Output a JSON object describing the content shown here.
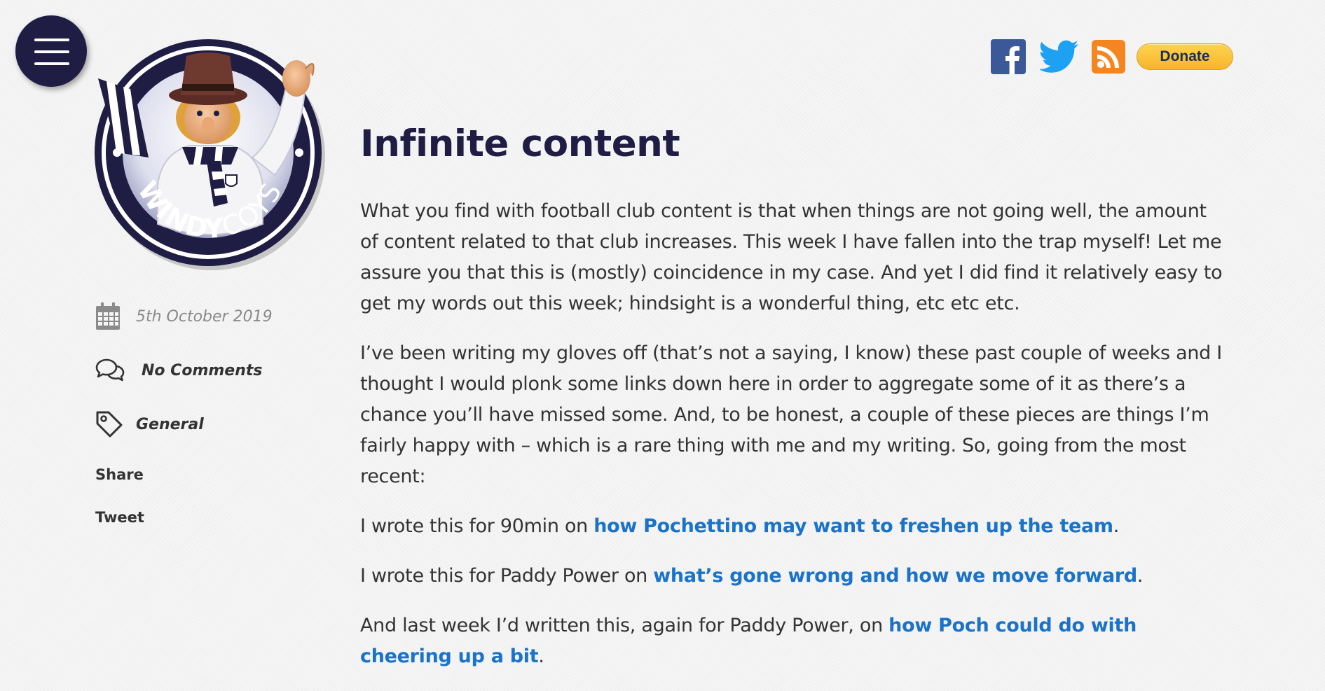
{
  "site": {
    "logo_text_bold": "WINDY",
    "logo_text_light": "COYS"
  },
  "header": {
    "donate_label": "Donate",
    "brand_colors": {
      "navy": "#201d44",
      "facebook": "#3b5998",
      "twitter": "#1da1f2",
      "rss": "#f5851f",
      "link": "#1a73c8"
    }
  },
  "meta": {
    "date": "5th October 2019",
    "comments": "No Comments",
    "category": "General",
    "share_label": "Share",
    "tweet_label": "Tweet"
  },
  "article": {
    "title": "Infinite content",
    "p1": "What you find with football club content is that when things are not going well, the amount of content related to that club increases. This week I have fallen into the trap myself! Let me assure you that this is (mostly) coincidence in my case. And yet I did find it relatively easy to get my words out this week; hindsight is a wonderful thing, etc etc etc.",
    "p2": "I’ve been writing my gloves off (that’s not a saying, I know) these past couple of weeks and I thought I would plonk some links down here in order to aggregate some of it as there’s a chance you’ll have missed some. And, to be honest, a couple of these pieces are things I’m fairly happy with – which is a rare thing with me and my writing. So, going from the most recent:",
    "p3_text": "I wrote this for 90min on ",
    "p3_link": "how Pochettino may want to freshen up the team",
    "p3_end": ".",
    "p4_text": "I wrote this for Paddy Power on ",
    "p4_link": "what’s gone wrong and how we move forward",
    "p4_end": ".",
    "p5_text": "And last week I’d written this, again for Paddy Power, on ",
    "p5_link": "how Poch could do with cheering up a bit",
    "p5_end": "."
  }
}
